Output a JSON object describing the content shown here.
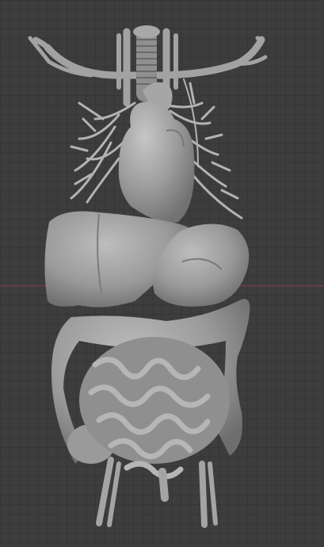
{
  "viewport": {
    "background_color": "#3d3d3d",
    "grid_color": "#363636",
    "x_axis_color": "#8a3a45"
  },
  "model": {
    "surface_color": "#9c9c9c",
    "shadow_color": "#6e6e6e",
    "highlight_color": "#bdbdbd",
    "parts": [
      "vessels",
      "lungs",
      "heart",
      "liver",
      "stomach",
      "colon",
      "small-intestine",
      "iliac-vessels"
    ]
  }
}
